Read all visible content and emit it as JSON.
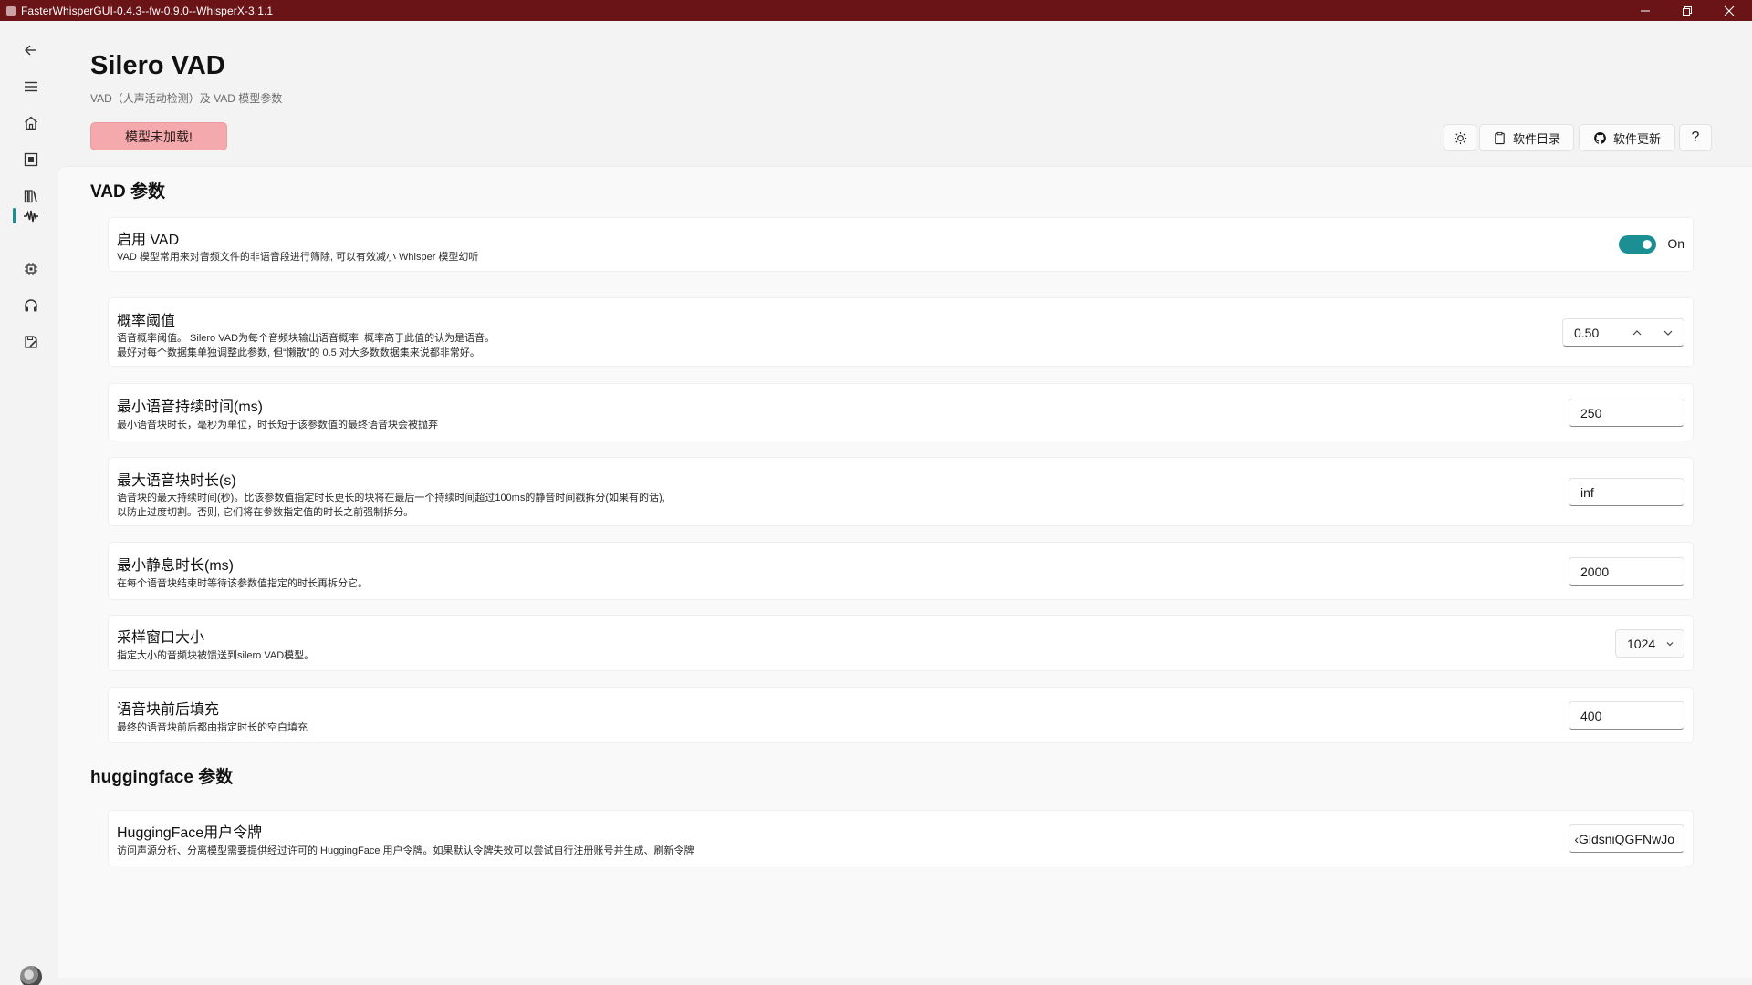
{
  "window": {
    "title": "FasterWhisperGUI-0.4.3--fw-0.9.0--WhisperX-3.1.1",
    "titlebar_color": "#6b1418"
  },
  "nav": {
    "items": [
      {
        "name": "back",
        "icon": "back-arrow-icon"
      },
      {
        "name": "menu",
        "icon": "hamburger-menu-icon"
      },
      {
        "name": "home",
        "icon": "home-icon"
      },
      {
        "name": "model",
        "icon": "model-frame-icon"
      },
      {
        "name": "library",
        "icon": "library-icon"
      },
      {
        "name": "vad",
        "icon": "waveform-icon",
        "selected": true
      },
      {
        "name": "processing",
        "icon": "chip-icon"
      },
      {
        "name": "audio",
        "icon": "headphones-icon"
      },
      {
        "name": "output",
        "icon": "save-edit-icon"
      }
    ],
    "accent": "#1b8f93"
  },
  "header": {
    "title": "Silero VAD",
    "subtitle": "VAD（人声活动检测）及 VAD 模型参数",
    "model_status": "模型未加载!",
    "model_status_color": "#f4a9ad"
  },
  "toolbar": {
    "theme_icon": "sun-icon",
    "software_dir": "软件目录",
    "software_update": "软件更新",
    "help": "?"
  },
  "vad_section": {
    "title": "VAD 参数",
    "enable": {
      "title": "启用 VAD",
      "desc": "VAD 模型常用来对音频文件的非语音段进行筛除, 可以有效减小 Whisper 模型幻听",
      "state": "On"
    },
    "threshold": {
      "title": "概率阈值",
      "desc1": "语音概率阈值。 Silero VAD为每个音频块输出语音概率, 概率高于此值的认为是语音。",
      "desc2": "最好对每个数据集单独调整此参数, 但“懒散”的 0.5 对大多数数据集来说都非常好。",
      "value": "0.50"
    },
    "min_speech": {
      "title": "最小语音持续时间(ms)",
      "desc": "最小语音块时长，毫秒为单位，时长短于该参数值的最终语音块会被抛弃",
      "value": "250"
    },
    "max_speech": {
      "title": "最大语音块时长(s)",
      "desc1": "语音块的最大持续时间(秒)。比该参数值指定时长更长的块将在最后一个持续时间超过100ms的静音时间戳拆分(如果有的话),",
      "desc2": "以防止过度切割。否则, 它们将在参数指定值的时长之前强制拆分。",
      "value": "inf"
    },
    "min_silence": {
      "title": "最小静息时长(ms)",
      "desc": "在每个语音块结束时等待该参数值指定的时长再拆分它。",
      "value": "2000"
    },
    "window_size": {
      "title": "采样窗口大小",
      "desc": "指定大小的音频块被馈送到silero VAD模型。",
      "value": "1024"
    },
    "speech_pad": {
      "title": "语音块前后填充",
      "desc": "最终的语音块前后都由指定时长的空白填充",
      "value": "400"
    }
  },
  "hf_section": {
    "title": "huggingface 参数",
    "token": {
      "title": "HuggingFace用户令牌",
      "desc": "访问声源分析、分离模型需要提供经过许可的 HuggingFace 用户令牌。如果默认令牌失效可以尝试自行注册账号并生成、刷新令牌",
      "value": "‹GldsniQGFNwJo"
    }
  }
}
